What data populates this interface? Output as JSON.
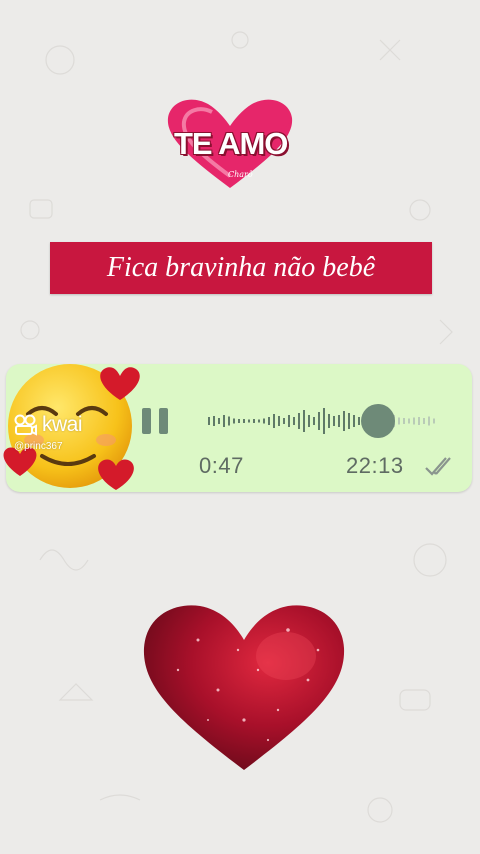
{
  "logo": {
    "text": "TE AMO",
    "sub": "Charô"
  },
  "banner": {
    "text": "Fica bravinha não bebê"
  },
  "voice_message": {
    "duration": "0:47",
    "time": "22:13",
    "progress": 0.72,
    "status_icon": "double-check-icon",
    "bubble_color": "#dcf8c6"
  },
  "watermark": {
    "brand": "kwai",
    "handle": "@princ367"
  },
  "colors": {
    "banner": "#c8173f",
    "heart": "#c4163e",
    "background": "#ecebe9"
  }
}
